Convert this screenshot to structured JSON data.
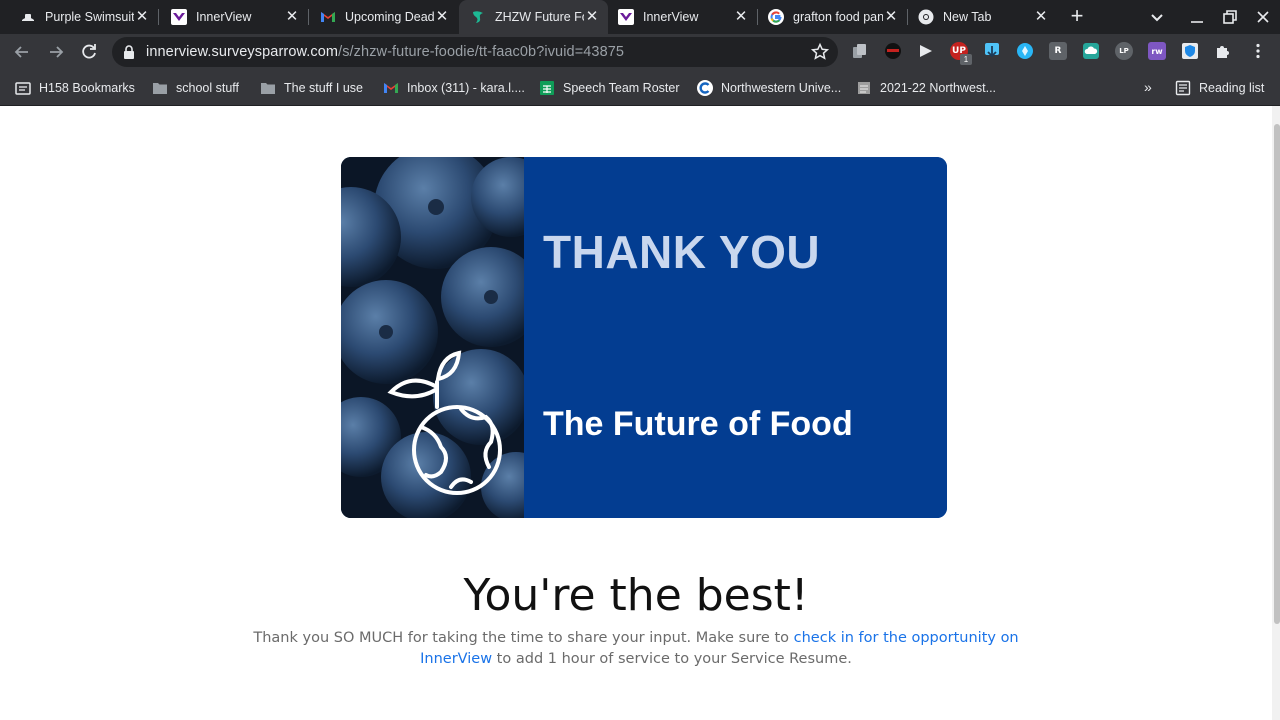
{
  "tabs": [
    {
      "title": "Purple Swimsuit",
      "icon": "hat-icon",
      "active": false
    },
    {
      "title": "InnerView",
      "icon": "innerview-logo-icon",
      "active": false
    },
    {
      "title": "Upcoming Deadlines",
      "icon": "gmail-icon",
      "active": false
    },
    {
      "title": "ZHZW Future Foodie",
      "icon": "surveysparrow-icon",
      "active": true
    },
    {
      "title": "InnerView",
      "icon": "innerview-logo-icon",
      "active": false
    },
    {
      "title": "grafton food pantry",
      "icon": "google-icon",
      "active": false
    },
    {
      "title": "New Tab",
      "icon": "chrome-icon",
      "active": false
    }
  ],
  "tab_close_glyph": "✕",
  "new_tab_glyph": "+",
  "toolbar": {
    "url_host": "innerview.surveysparrow.com",
    "url_path": "/s/zhzw-future-foodie/tt-faac0b?ivuid=43875"
  },
  "extensions": [
    {
      "icon": "copy-extension-icon",
      "color": "#9aa0a6",
      "label": ""
    },
    {
      "icon": "ninja-extension-icon",
      "color": "#202124",
      "label": ""
    },
    {
      "icon": "cast-extension-icon",
      "color": "#e8eaed",
      "label": ""
    },
    {
      "icon": "up-extension-icon",
      "color": "#c5221f",
      "label": "UP",
      "badge": "1"
    },
    {
      "icon": "download-extension-icon",
      "color": "#4fc3f7",
      "label": ""
    },
    {
      "icon": "compass-extension-icon",
      "color": "#29b6f6",
      "label": ""
    },
    {
      "icon": "r-extension-icon",
      "color": "#5f6368",
      "label": "R"
    },
    {
      "icon": "cloud-extension-icon",
      "color": "#26a69a",
      "label": ""
    },
    {
      "icon": "lp-extension-icon",
      "color": "#5f6368",
      "label": "LP"
    },
    {
      "icon": "rw-extension-icon",
      "color": "#7e57c2",
      "label": "rw"
    },
    {
      "icon": "shield-extension-icon",
      "color": "#1e88e5",
      "label": ""
    }
  ],
  "bookmarks": [
    {
      "label": "H158 Bookmarks",
      "icon": "bookmark-folder-icon"
    },
    {
      "label": "school stuff",
      "icon": "folder-icon"
    },
    {
      "label": "The stuff I use",
      "icon": "folder-icon"
    },
    {
      "label": "Inbox (311) - kara.l....",
      "icon": "gmail-icon"
    },
    {
      "label": "Speech Team Roster",
      "icon": "sheets-icon"
    },
    {
      "label": "Northwestern Unive...",
      "icon": "northwestern-c-icon"
    },
    {
      "label": "2021-22 Northwest...",
      "icon": "document-icon"
    }
  ],
  "bookmarks_overflow": "»",
  "reading_list_label": "Reading list",
  "banner": {
    "title": "THANK YOU",
    "subtitle": "The Future of Food"
  },
  "headline": "You're the best!",
  "message": {
    "before_link": "Thank you SO MUCH for taking the time to share your input. Make sure to ",
    "link_text": "check in for the opportunity on InnerView",
    "after_link": " to add 1 hour of service to your Service Resume."
  },
  "colors": {
    "link": "#1a73e8",
    "banner_blue": "#033d91",
    "banner_title": "#c9d7ee"
  }
}
